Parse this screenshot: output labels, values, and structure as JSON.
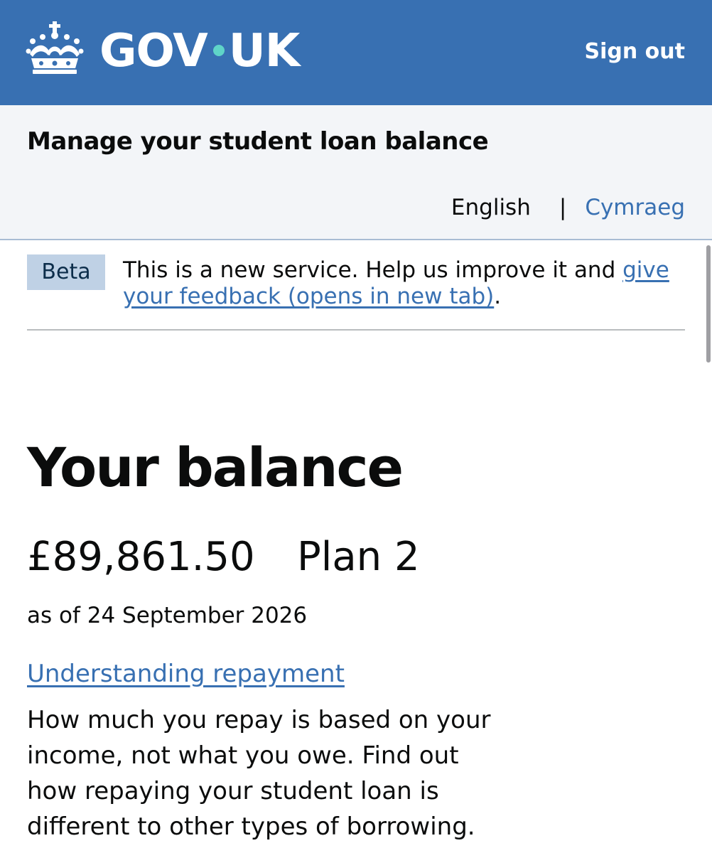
{
  "header": {
    "logo_text_left": "GOV",
    "logo_text_right": "UK",
    "sign_out_label": "Sign out",
    "colors": {
      "header_bg": "#3870b2",
      "logo_dot": "#5fd4c8"
    }
  },
  "service": {
    "name": "Manage your student loan balance",
    "languages": {
      "current": "English",
      "separator": "|",
      "alternate": "Cymraeg"
    }
  },
  "beta_banner": {
    "tag": "Beta",
    "text_before": "This is a new service. Help us improve it and ",
    "link_text": "give your feedback (opens in new tab)",
    "text_after": "."
  },
  "main": {
    "heading": "Your balance",
    "balance_amount": "£89,861.50",
    "plan": "Plan 2",
    "as_of": "as of 24 September 2026",
    "understanding_link": "Understanding repayment",
    "understanding_body": "How much you repay is based on your income, not what you owe. Find out how repaying your student loan is different to other types of borrowing."
  },
  "icons": {
    "crown": "crown-icon"
  }
}
